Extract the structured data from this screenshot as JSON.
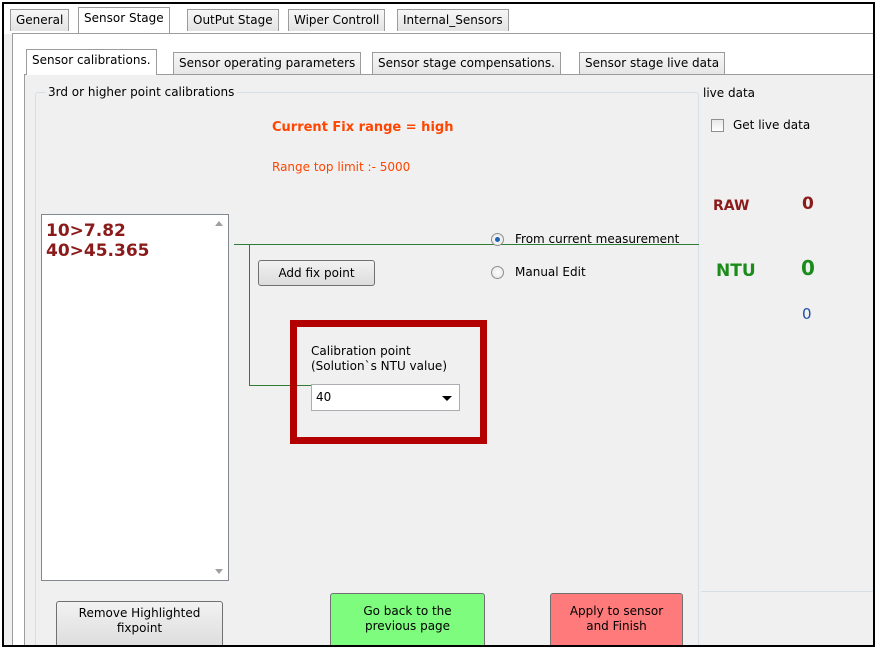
{
  "tabs": [
    "General",
    "Sensor Stage",
    "OutPut Stage",
    "Wiper Controll",
    "Internal_Sensors"
  ],
  "active_tab": "Sensor Stage",
  "subtabs": [
    "Sensor calibrations.",
    "Sensor operating parameters",
    "Sensor stage compensations.",
    "Sensor stage live data"
  ],
  "active_subtab": "Sensor calibrations.",
  "calib_group": {
    "title": "3rd or higher point calibrations",
    "fix_range_text": "Current  Fix range = high",
    "range_limit_text": "Range top limit :-   5000",
    "fix_points": [
      "10>7.82",
      "40>45.365"
    ],
    "add_button": "Add fix point",
    "radio_from_current": "From current measurement",
    "radio_manual": "Manual Edit",
    "radio_selected": "From current measurement",
    "calib_point_label_1": "Calibration point",
    "calib_point_label_2": "(Solution`s NTU value)",
    "calib_value": "40",
    "remove_button_1": "Remove Highlighted",
    "remove_button_2": "fixpoint",
    "back_button_1": "Go back to the",
    "back_button_2": "previous page",
    "apply_button_1": "Apply to sensor",
    "apply_button_2": "and Finish"
  },
  "live_data": {
    "title": "live data",
    "checkbox_label": "Get live data",
    "raw_label": "RAW",
    "raw_value": "0",
    "ntu_label": "NTU",
    "ntu_value": "0",
    "extra_value": "0"
  },
  "colors": {
    "accent_orange": "#ff4500",
    "dark_red": "#8b1a1a",
    "ntu_green": "#1a8c1a",
    "blue_value": "#1f4fa0",
    "highlight_red": "#b30000",
    "back_green": "#7dfc7d",
    "apply_red": "#ff7b7b"
  }
}
